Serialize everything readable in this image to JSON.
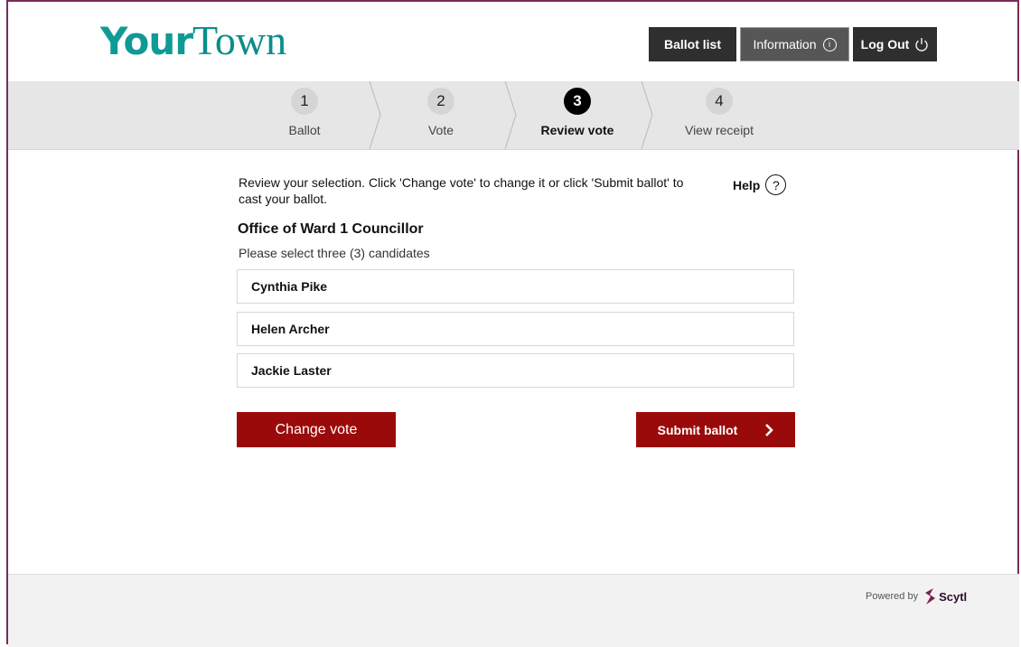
{
  "header": {
    "logo_your": "Your",
    "logo_town": "Town",
    "buttons": {
      "ballot_list": "Ballot list",
      "information": "Information",
      "logout": "Log Out"
    }
  },
  "steps": [
    {
      "number": "1",
      "label": "Ballot",
      "active": false
    },
    {
      "number": "2",
      "label": "Vote",
      "active": false
    },
    {
      "number": "3",
      "label": "Review vote",
      "active": true
    },
    {
      "number": "4",
      "label": "View receipt",
      "active": false
    }
  ],
  "review": {
    "instruction": "Review your selection. Click 'Change vote' to change it or click 'Submit ballot' to cast your ballot.",
    "help_label": "Help",
    "office_title": "Office of Ward 1 Councillor",
    "select_instruction": "Please select three (3) candidates",
    "candidates": [
      "Cynthia Pike",
      "Helen Archer",
      "Jackie Laster"
    ]
  },
  "actions": {
    "change_vote": "Change vote",
    "submit_ballot": "Submit ballot"
  },
  "footer": {
    "powered_by": "Powered by",
    "brand": "Scytl"
  },
  "colors": {
    "brand_teal": "#0f9a96",
    "action_red": "#9b0a0a",
    "frame_purple": "#7a2b59",
    "dark_button": "#2f2f2f"
  },
  "icons": [
    "info-icon",
    "power-icon",
    "help-icon",
    "chevron-right-icon",
    "scytl-logo-icon"
  ]
}
